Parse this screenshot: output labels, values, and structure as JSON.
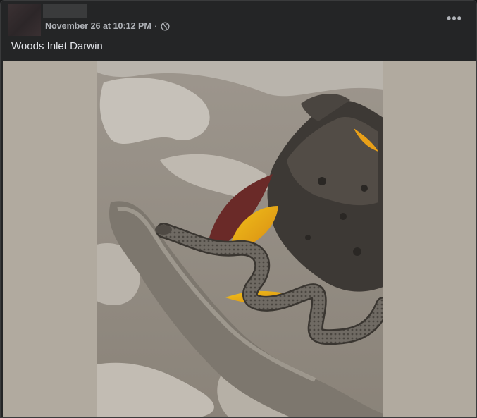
{
  "post": {
    "author_name": "",
    "timestamp": "November 26 at 10:12 PM",
    "separator": "·",
    "privacy_icon": "globe-icon",
    "more_label": "•••",
    "caption": "Woods Inlet Darwin"
  },
  "colors": {
    "background": "#242526",
    "text_primary": "#e4e6eb",
    "text_secondary": "#b0b3b8",
    "media_backdrop": "#b1aa9f"
  }
}
